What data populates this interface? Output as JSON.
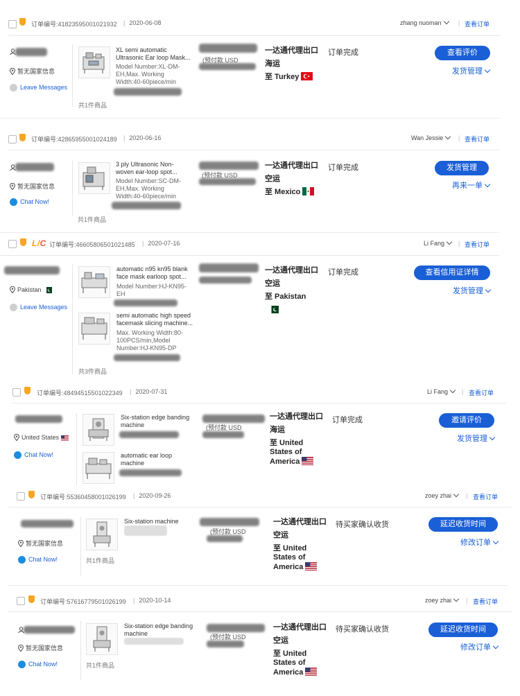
{
  "labels": {
    "order_no_prefix": "订单编号:",
    "view_order": "查看订单",
    "items_suffix": "件商品",
    "items_prefix": "共",
    "prepay": "(预付款 USD",
    "shipping_method": "一达通代理出口",
    "leave_messages": "Leave Messages",
    "chat_now": "Chat Now!",
    "no_country": "暂无国家信息",
    "lc_badge_l": "L/",
    "lc_badge_c": "C"
  },
  "orders": [
    {
      "order_no": "41823595001021932",
      "date": "2020-06-08",
      "staff": "zhang nuoman",
      "country_text": "暂无国家信息",
      "message_label": "Leave Messages",
      "products": [
        {
          "title": "XL semi automatic Ultrasonic Ear loop Mask...",
          "model": "Model Number:XL-DM-EH,Max. Working Width:40-60piece/min"
        }
      ],
      "item_count": "共1件商品",
      "prepay": "(预付款 USD",
      "shipping": "一达通代理出口",
      "transport": "海运",
      "destination": "至 Turkey",
      "status": "订单完成",
      "primary_action": "查看评价",
      "secondary_action": "发货管理"
    },
    {
      "order_no": "42865955001024189",
      "date": "2020-06-16",
      "staff": "Wan Jessie",
      "country_text": "暂无国家信息",
      "message_label": "Chat Now!",
      "products": [
        {
          "title": "3 ply Ultrasonic Non-woven ear-loop spot...",
          "model": "Model Number:SC-DM-EH,Max. Working Width:40-60piece/min"
        }
      ],
      "item_count": "共1件商品",
      "prepay": "(预付款 USD",
      "shipping": "一达通代理出口",
      "transport": "空运",
      "destination": "至 Mexico",
      "status": "订单完成",
      "primary_action": "发货管理",
      "secondary_action": "再来一单"
    },
    {
      "order_no": "46605806501021485",
      "date": "2020-07-16",
      "staff": "Li Fang",
      "country_text": "Pakistan",
      "message_label": "Leave Messages",
      "products": [
        {
          "title": "automatic n95 kn95 blank face mask earloop spot...",
          "model": "Model Number:HJ-KN95-EH"
        },
        {
          "title": "semi automatic high speed facemask slicing machine...",
          "model": "Max. Working Width:80-100PCS/min,Model Number:HJ-KN95-DP"
        }
      ],
      "item_count": "共3件商品",
      "shipping": "一达通代理出口",
      "transport": "空运",
      "destination": "至 Pakistan",
      "status": "订单完成",
      "primary_action": "查看信用证详情",
      "secondary_action": "发货管理"
    },
    {
      "order_no": "48494515501022349",
      "date": "2020-07-31",
      "staff": "Li Fang",
      "country_text": "United States",
      "message_label": "Chat Now!",
      "products": [
        {
          "title": "Six-station edge banding machine",
          "model": ""
        },
        {
          "title": "automatic ear loop machine",
          "model": ""
        }
      ],
      "prepay": "(预付款 USD",
      "shipping": "一达通代理出口",
      "transport": "海运",
      "destination": "至 United States of America",
      "status": "订单完成",
      "primary_action": "邀请评价",
      "secondary_action": "发货管理"
    },
    {
      "order_no": "55360458001026199",
      "date": "2020-09-26",
      "staff": "zoey zhai",
      "country_text": "暂无国家信息",
      "message_label": "Chat Now!",
      "products": [
        {
          "title": "Six-station machine",
          "model": ""
        }
      ],
      "item_count": "共1件商品",
      "prepay": "(预付款 USD",
      "shipping": "一达通代理出口",
      "transport": "空运",
      "destination": "至 United States of America",
      "status": "待买家确认收货",
      "primary_action": "延迟收货时间",
      "secondary_action": "修改订单"
    },
    {
      "order_no": "57616779501026199",
      "date": "2020-10-14",
      "staff": "zoey zhai",
      "country_text": "暂无国家信息",
      "message_label": "Chat Now!",
      "products": [
        {
          "title": "Six-station edge banding machine",
          "model": ""
        }
      ],
      "item_count": "共1件商品",
      "prepay": "(预付款 USD",
      "shipping": "一达通代理出口",
      "transport": "空运",
      "destination": "至 United States of America",
      "status": "待买家确认收货",
      "primary_action": "延迟收货时间",
      "secondary_action": "修改订单"
    }
  ],
  "colors": {
    "link": "#1a5fd6",
    "button_bg": "#1a5fd6",
    "shield": "#f5a623"
  }
}
